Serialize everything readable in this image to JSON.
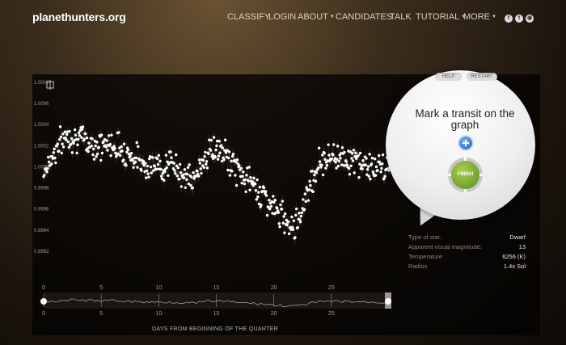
{
  "site": {
    "logo": "planethunters.org"
  },
  "nav": [
    {
      "label": "CLASSIFY",
      "dropdown": false
    },
    {
      "label": "LOGIN",
      "dropdown": false
    },
    {
      "label": "ABOUT",
      "dropdown": true
    },
    {
      "label": "CANDIDATES",
      "dropdown": false
    },
    {
      "label": "TALK",
      "dropdown": false
    },
    {
      "label": "TUTORIAL",
      "dropdown": true
    },
    {
      "label": "MORE",
      "dropdown": true
    }
  ],
  "social_icons": [
    "facebook-icon",
    "twitter-icon",
    "rss-icon"
  ],
  "bubble": {
    "help_label": "HELP",
    "restart_label": "RESTART",
    "prompt": "Mark a transit on the graph",
    "add_icon": "plus-icon",
    "finish_label": "FINISH"
  },
  "star_info": [
    {
      "label": "Type of star:",
      "value": "Dwarf"
    },
    {
      "label": "Apparent visual magnitude:",
      "value": "13"
    },
    {
      "label": "Temperature",
      "value": "6256 (K)"
    },
    {
      "label": "Radius",
      "value": "1.4x Sol"
    }
  ],
  "chart_data": {
    "type": "scatter",
    "xlabel": "DAYS FROM BEGINNING OF THE QUARTER",
    "ylabel": "",
    "xlim": [
      0,
      30
    ],
    "ylim": [
      0.999,
      1.0008
    ],
    "x_ticks": [
      "0",
      "5",
      "10",
      "15",
      "20",
      "25"
    ],
    "y_ticks": [
      "1.0008",
      "1.0006",
      "1.0004",
      "1.0002",
      "1.0000",
      "0.9998",
      "0.9996",
      "0.9994",
      "0.9992"
    ],
    "trend": [
      [
        0,
        0.99995
      ],
      [
        1,
        1.00015
      ],
      [
        2,
        1.0003
      ],
      [
        3,
        1.00028
      ],
      [
        4,
        1.00022
      ],
      [
        5,
        1.0002
      ],
      [
        6,
        1.00022
      ],
      [
        7,
        1.00015
      ],
      [
        8,
        1.00008
      ],
      [
        9,
        1.00002
      ],
      [
        10,
        1.0
      ],
      [
        11,
        1.00003
      ],
      [
        12,
        0.99995
      ],
      [
        13,
        0.99985
      ],
      [
        14,
        1.0001
      ],
      [
        15,
        1.00018
      ],
      [
        16,
        1.00008
      ],
      [
        17,
        0.99995
      ],
      [
        18,
        0.99985
      ],
      [
        19,
        0.99975
      ],
      [
        20,
        0.9996
      ],
      [
        21,
        0.9995
      ],
      [
        22,
        0.99945
      ],
      [
        23,
        0.9998
      ],
      [
        24,
        1.00005
      ],
      [
        25,
        1.0001
      ],
      [
        26,
        1.0001
      ],
      [
        27,
        1.00005
      ],
      [
        28,
        1.00002
      ],
      [
        29,
        0.99998
      ],
      [
        30,
        0.99998
      ]
    ],
    "scatter_amplitude": 0.00013,
    "grid": false,
    "legend": "none"
  }
}
